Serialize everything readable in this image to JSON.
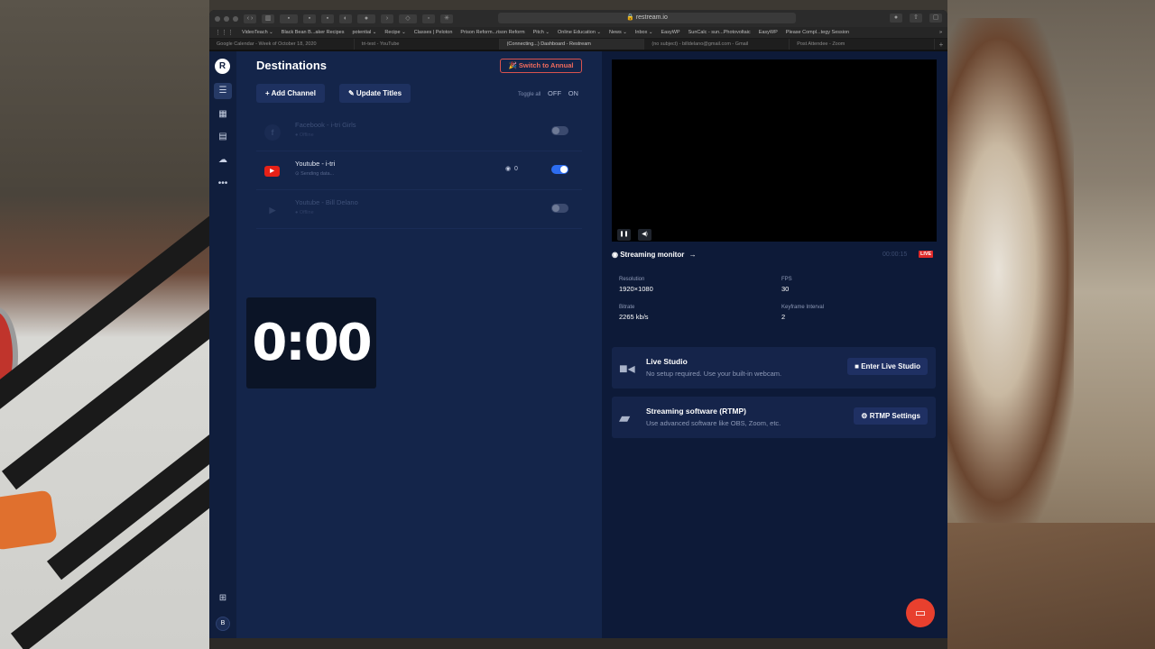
{
  "browser": {
    "url": "restream.io",
    "bookmarks": [
      "VideoTeach ⌄",
      "Black Bean B...aker Recipes",
      "potential ⌄",
      "Recipe ⌄",
      "Classes | Peloton",
      "Prison Reform...rison Reform",
      "Pitch ⌄",
      "Online Education ⌄",
      "News ⌄",
      "Inbox ⌄",
      "EasyWP",
      "SunCalc - sun...Photovoltaic",
      "EasyWP",
      "Please Compl...tegy Session"
    ],
    "tabs": [
      "Google Calendar - Week of October 18, 2020",
      "tri-test - YouTube",
      "(Connecting...) Dashboard - Restream",
      "(no subject) - billdelano@gmail.com - Gmail",
      "Post Attendee - Zoom"
    ],
    "active_tab": 2
  },
  "app": {
    "logo": "R",
    "avatar": "B",
    "destinations": {
      "title": "Destinations",
      "switch_annual": "🎉 Switch to Annual",
      "add_channel": "+ Add Channel",
      "update_titles": "✎ Update Titles",
      "toggle_all_label": "Toggle all",
      "toggle_off": "OFF",
      "toggle_on": "ON",
      "channels": [
        {
          "icon": "f",
          "name": "Facebook - i-tri Girls",
          "status": "● Offline",
          "enabled": false
        },
        {
          "icon": "▶",
          "name": "Youtube - i-tri",
          "status": "⊙ Sending data...",
          "views": "0",
          "enabled": true
        },
        {
          "icon": "▶",
          "name": "Youtube - Bill Delano",
          "status": "● Offline",
          "enabled": false
        }
      ]
    },
    "timer": "0:00",
    "monitor": {
      "label": "Streaming monitor",
      "arrow": "→",
      "timecode": "00:00:15",
      "live_badge": "LIVE",
      "stats": [
        {
          "label": "Resolution",
          "value": "1920×1080"
        },
        {
          "label": "FPS",
          "value": "30"
        },
        {
          "label": "Bitrate",
          "value": "2265 kb/s"
        },
        {
          "label": "Keyframe Interval",
          "value": "2"
        }
      ]
    },
    "live_studio": {
      "title": "Live Studio",
      "subtitle": "No setup required. Use your built-in webcam.",
      "button": "Enter Live Studio"
    },
    "rtmp": {
      "title": "Streaming software (RTMP)",
      "subtitle": "Use advanced software like OBS, Zoom, etc.",
      "button": "RTMP Settings"
    }
  },
  "colors": {
    "sidebar": "#101e3d",
    "panel": "#14254a",
    "accent_red": "#e8402e",
    "toggle_on": "#2d6df0"
  }
}
